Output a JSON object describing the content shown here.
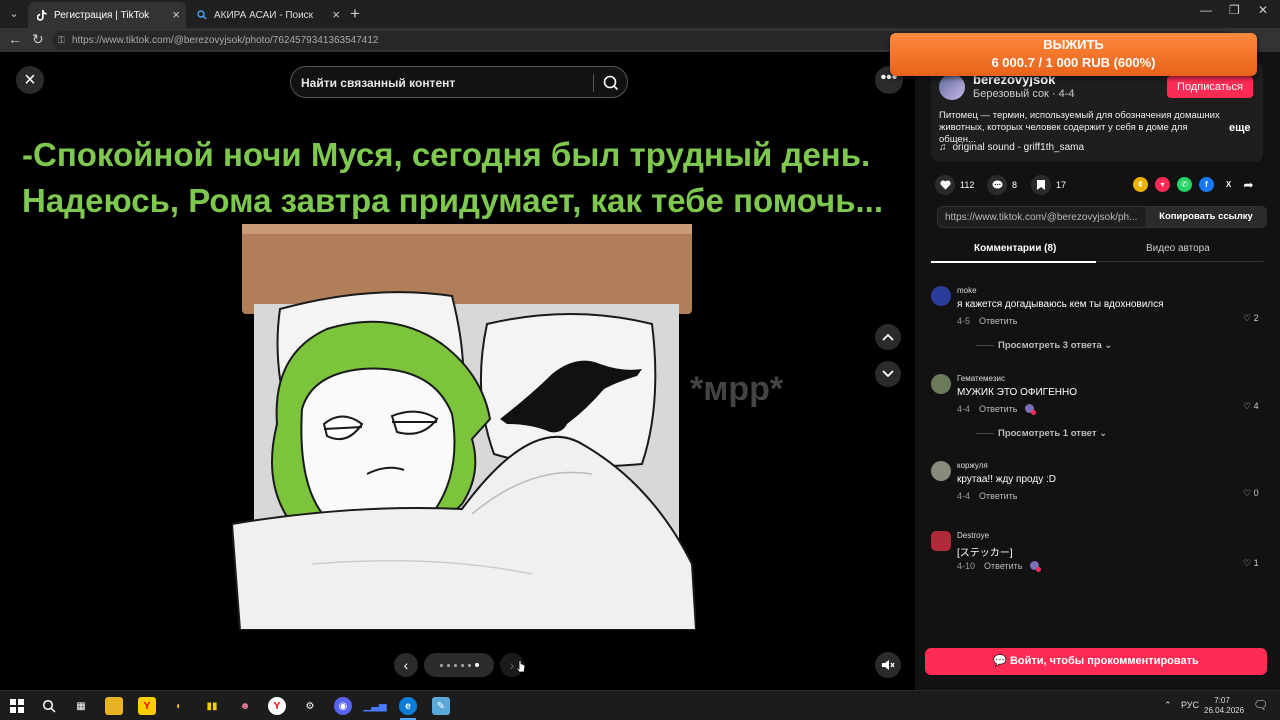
{
  "browser": {
    "tabs": [
      {
        "title": "Регистрация | TikTok"
      },
      {
        "title": "АКИРА АСАИ - Поиск"
      }
    ],
    "url": "https://www.tiktok.com/@berezovyjsok/photo/7624579341363547412"
  },
  "viewer": {
    "search_placeholder": "Найти связанный контент",
    "caption_line1": "-Спокойной ночи Муся, сегодня был трудный день.",
    "caption_line2": "Надеюсь, Рома завтра придумает, как тебе помочь...",
    "sound_effect": "*мрр*",
    "photo_count": 6,
    "current_photo": 6
  },
  "author": {
    "username": "berezovyjsok",
    "display_line": "Березовый сок · 4-4",
    "follow_label": "Подписаться",
    "description": "Питомец — термин, используемый для обозначения домашних животных, которых человек содержит у себя в доме для общен...",
    "more_label": "еще",
    "sound": "original sound - griff1th_sama"
  },
  "stats": {
    "likes": "112",
    "comments": "8",
    "saves": "17"
  },
  "share": {
    "link_text": "https://www.tiktok.com/@berezovyjsok/ph...",
    "copy_label": "Копировать ссылку"
  },
  "panel_tabs": {
    "comments": "Комментарии (8)",
    "author_videos": "Видео автора"
  },
  "comments": [
    {
      "name": "moke",
      "text": "я кажется догадываюсь кем ты вдохновился",
      "date": "4-5",
      "reply": "Ответить",
      "likes": "2",
      "replies": "Просмотреть 3 ответа",
      "avatar_color": "#2a3b9a"
    },
    {
      "name": "Гематемезис",
      "text": "МУЖИК ЭТО ОФИГЕННО",
      "date": "4-4",
      "reply": "Ответить",
      "likes": "4",
      "replies": "Просмотреть 1 ответ",
      "avatar_color": "#6b7b5a"
    },
    {
      "name": "коржуля",
      "text": "крутаа!! жду проду :D",
      "date": "4-4",
      "reply": "Ответить",
      "likes": "0",
      "replies": "",
      "avatar_color": "#8a8a7a"
    },
    {
      "name": "Destroye",
      "text": "[ステッカー]",
      "date": "4-10",
      "reply": "Ответить",
      "likes": "1",
      "replies": "",
      "avatar_color": "#b02a3a"
    }
  ],
  "login_prompt": "Войти, чтобы прокомментировать",
  "ad": {
    "line1": "ВЫЖИТЬ",
    "line2": "6 000.7 / 1 000 RUB (600%)"
  },
  "taskbar": {
    "language": "РУС",
    "time": "7:07",
    "date": "26.04.2026"
  },
  "colors": {
    "accent": "#fe2c55",
    "caption_green": "#7ec850",
    "ad_orange": "#e8621a"
  }
}
